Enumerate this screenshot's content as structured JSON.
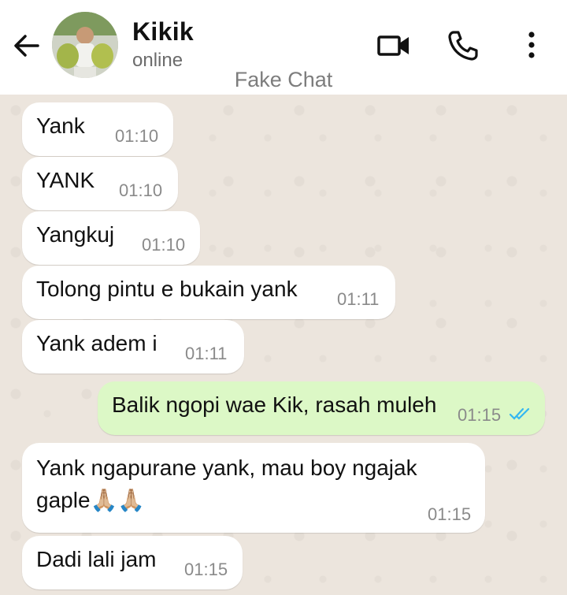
{
  "header": {
    "contact_name": "Kikik",
    "status": "online",
    "watermark": "Fake Chat"
  },
  "icons": {
    "back": "arrow-left-icon",
    "video": "video-camera-icon",
    "call": "phone-icon",
    "menu": "more-vertical-icon"
  },
  "messages": [
    {
      "direction": "in",
      "text": "Yank",
      "time": "01:10"
    },
    {
      "direction": "in",
      "text": "YANK",
      "time": "01:10"
    },
    {
      "direction": "in",
      "text": "Yangkuj",
      "time": "01:10"
    },
    {
      "direction": "in",
      "text": "Tolong pintu e bukain yank",
      "time": "01:11"
    },
    {
      "direction": "in",
      "text": "Yank adem i",
      "time": "01:11"
    },
    {
      "direction": "out",
      "text": "Balik ngopi wae Kik, rasah muleh",
      "time": "01:15",
      "status": "read"
    },
    {
      "direction": "in",
      "text_line1": "Yank ngapurane yank, mau boy ngajak",
      "text_line2": "gaple",
      "emoji": "🙏🏼🙏🏼",
      "time": "01:15"
    },
    {
      "direction": "in",
      "text": "Dadi lali jam",
      "time": "01:15"
    }
  ],
  "colors": {
    "incoming_bubble": "#ffffff",
    "outgoing_bubble": "#dcf8c6",
    "read_ticks": "#34b7f1",
    "chat_background": "#ece5dd"
  }
}
